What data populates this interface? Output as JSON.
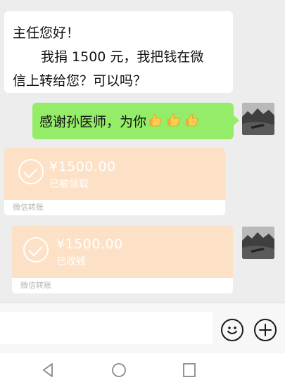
{
  "messages": {
    "incoming_text": {
      "line1": "主任您好！",
      "line2": "我捐 1500 元，我把钱在微",
      "line3": "信上转给您？可以吗？"
    },
    "outgoing_text": {
      "text": "感谢孙医师，为你",
      "emoji": [
        "thumbs-up",
        "thumbs-up",
        "thumbs-up"
      ]
    },
    "transfer_received": {
      "amount": "¥1500.00",
      "status": "已被领取",
      "footer": "微信转账"
    },
    "transfer_sent": {
      "amount": "¥1500.00",
      "status": "已收钱",
      "footer": "微信转账"
    }
  },
  "input_bar": {
    "icons": [
      "emoji-icon",
      "plus-icon"
    ]
  },
  "nav_bar": {
    "icons": [
      "back-icon",
      "home-icon",
      "recent-apps-icon"
    ]
  },
  "colors": {
    "chat_background": "#ededed",
    "outgoing_bubble": "#95ec69",
    "incoming_bubble": "#ffffff",
    "transfer_card": "#fde1c6"
  }
}
